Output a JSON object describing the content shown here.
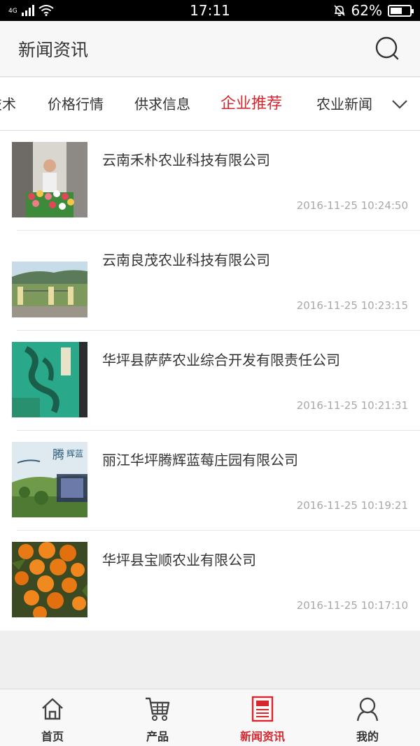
{
  "status_bar": {
    "network": "4G",
    "time": "17:11",
    "battery": "62%",
    "battery_level": 0.62
  },
  "header": {
    "title": "新闻资讯",
    "search_icon": "search-icon"
  },
  "tabs": [
    {
      "label": "技术",
      "active": false
    },
    {
      "label": "价格行情",
      "active": false
    },
    {
      "label": "供求信息",
      "active": false
    },
    {
      "label": "企业推荐",
      "active": true
    },
    {
      "label": "农业新闻",
      "active": false
    }
  ],
  "tabs_more_icon": "chevron-down-icon",
  "news": [
    {
      "title": "云南禾朴农业科技有限公司",
      "time": "2016-11-25 10:24:50"
    },
    {
      "title": "云南良茂农业科技有限公司",
      "time": "2016-11-25 10:23:15"
    },
    {
      "title": "华坪县萨萨农业综合开发有限责任公司",
      "time": "2016-11-25 10:21:31"
    },
    {
      "title": "丽江华坪腾辉蓝莓庄园有限公司",
      "time": "2016-11-25 10:19:21"
    },
    {
      "title": "华坪县宝顺农业有限公司",
      "time": "2016-11-25 10:17:10"
    }
  ],
  "thumb_text": {
    "item4_brand": "腾",
    "item4_brand2": "辉蓝"
  },
  "bottom_nav": [
    {
      "label": "首页",
      "icon": "home-icon",
      "active": false
    },
    {
      "label": "产品",
      "icon": "cart-icon",
      "active": false
    },
    {
      "label": "新闻资讯",
      "icon": "news-icon",
      "active": true
    },
    {
      "label": "我的",
      "icon": "user-icon",
      "active": false
    }
  ],
  "colors": {
    "accent": "#d6272e",
    "text": "#333333",
    "time_text": "#a8a8a8",
    "background": "#efefef"
  }
}
